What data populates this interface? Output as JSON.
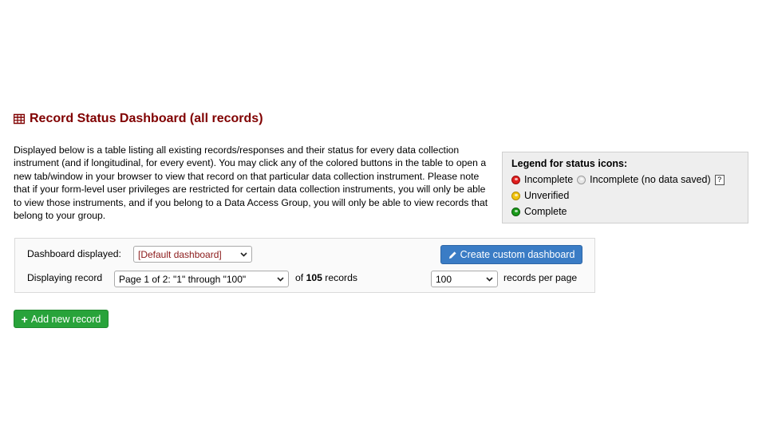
{
  "header": {
    "title": "Record Status Dashboard (all records)",
    "icon": "table-icon"
  },
  "intro": {
    "text": "Displayed below is a table listing all existing records/responses and their status for every data collection instrument (and if longitudinal, for every event). You may click any of the colored buttons in the table to open a new tab/window in your browser to view that record on that particular data collection instrument. Please note that if your form-level user privileges are restricted for certain data collection instruments, you will only be able to view those instruments, and if you belong to a Data Access Group, you will only be able to view records that belong to your group."
  },
  "legend": {
    "title": "Legend for status icons:",
    "items": {
      "incomplete": "Incomplete",
      "incomplete_no_data": "Incomplete (no data saved)",
      "help": "?",
      "unverified": "Unverified",
      "complete": "Complete"
    },
    "colors": {
      "incomplete": "#e02020",
      "incomplete_no_data": "#e6e6e6",
      "unverified": "#f1c40f",
      "complete": "#1a9a1a"
    }
  },
  "controls": {
    "dashboard_label": "Dashboard displayed:",
    "dashboard_value": "[Default dashboard]",
    "create_button": "Create custom dashboard",
    "displaying_label": "Displaying record",
    "page_value": "Page 1 of 2: \"1\" through \"100\"",
    "of_text": "of",
    "record_count": "105",
    "records_text": "records",
    "per_page_value": "100",
    "per_page_label": "records per page"
  },
  "actions": {
    "add_record": "Add new record"
  },
  "colors": {
    "title": "#800000",
    "primary_button": "#3a7cc5",
    "success_button": "#28a33a"
  }
}
